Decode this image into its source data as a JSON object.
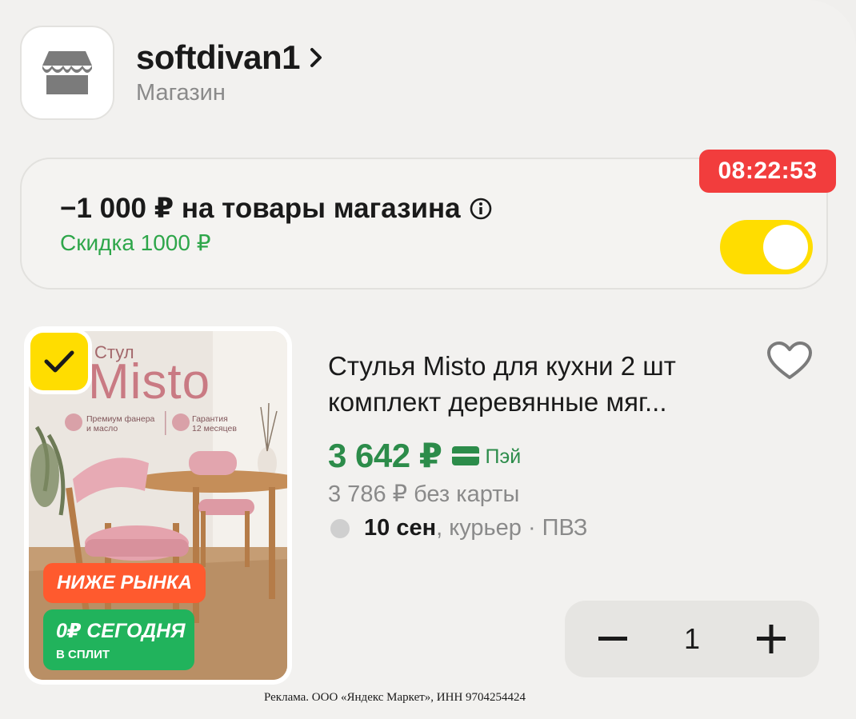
{
  "shop": {
    "name": "softdivan1",
    "type": "Магазин",
    "chevron": "›"
  },
  "promo": {
    "title": "−1 000 ₽ на товары магазина",
    "subtitle": "Скидка 1000 ₽",
    "timer": "08:22:53",
    "toggle_on": true
  },
  "product": {
    "title": "Стулья Misto для кухни 2 шт комплект деревянные мяг...",
    "price": "3 642 ₽",
    "pay_label": "Пэй",
    "old_price": "3 786 ₽  без карты",
    "delivery_date": "10 сен",
    "delivery_rest": ", курьер · ПВЗ",
    "quantity": "1",
    "image": {
      "small_caption": "Стул",
      "brand": "Misto",
      "feature1": "Премиум фанера\nи масло",
      "feature2": "Гарантия\n12 месяцев",
      "badge_lower": "НИЖЕ РЫНКА",
      "badge_split_line1": "0₽ СЕГОДНЯ",
      "badge_split_line2": "В СПЛИТ"
    }
  },
  "disclaimer": "Реклама. ООО «Яндекс Маркет», ИНН 9704254424",
  "colors": {
    "accent_yellow": "#ffdd00",
    "price_green": "#2c8c4a",
    "discount_green": "#2ea64a",
    "timer_red": "#f23d3d"
  },
  "icons": {
    "shop": "storefront-icon",
    "info": "info-icon",
    "check": "check-icon",
    "heart": "heart-icon",
    "card": "card-icon",
    "minus": "minus-icon",
    "plus": "plus-icon"
  }
}
